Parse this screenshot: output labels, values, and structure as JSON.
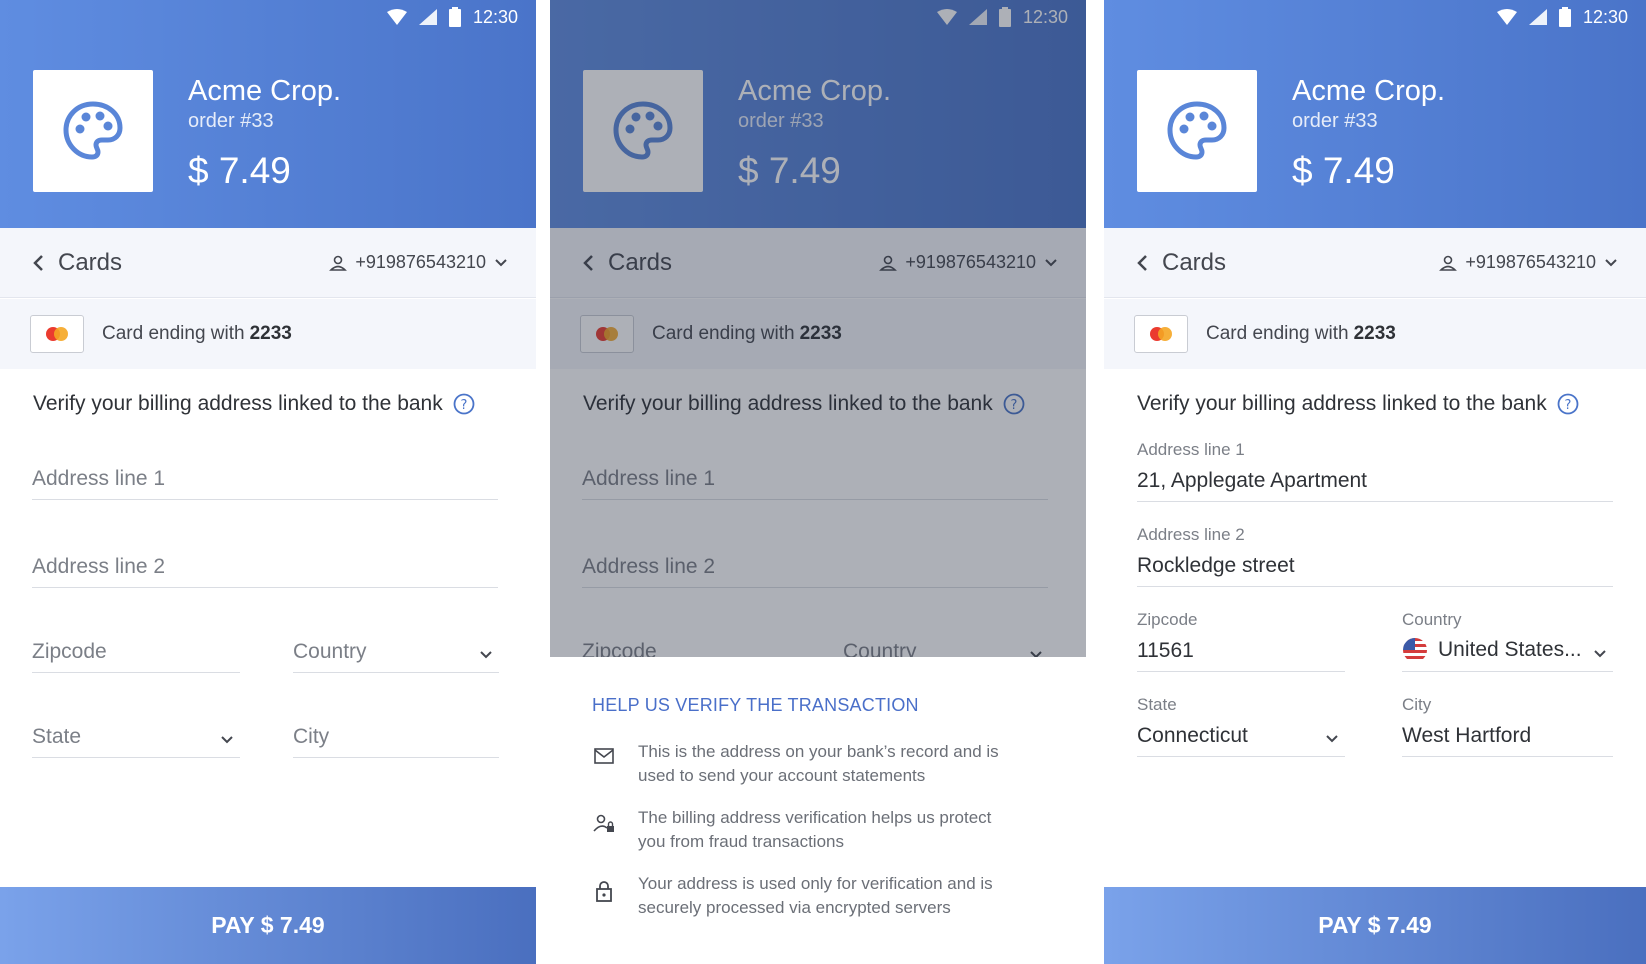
{
  "status": {
    "time": "12:30"
  },
  "merchant": {
    "name": "Acme Crop.",
    "order": "order #33",
    "amount": "$ 7.49"
  },
  "cards_bar": {
    "back_label": "Cards",
    "phone": "+919876543210"
  },
  "card": {
    "prefix": "Card ending with",
    "last4": "2233"
  },
  "verify": {
    "heading": "Verify your billing address linked to the bank"
  },
  "form_empty": {
    "address1_placeholder": "Address line 1",
    "address2_placeholder": "Address line 2",
    "zipcode_placeholder": "Zipcode",
    "country_placeholder": "Country",
    "state_placeholder": "State",
    "city_placeholder": "City"
  },
  "form_filled": {
    "address1_label": "Address line 1",
    "address1_value": "21, Applegate Apartment",
    "address2_label": "Address line 2",
    "address2_value": "Rockledge street",
    "zipcode_label": "Zipcode",
    "zipcode_value": "11561",
    "country_label": "Country",
    "country_value": "United States...",
    "state_label": "State",
    "state_value": "Connecticut",
    "city_label": "City",
    "city_value": "West Hartford"
  },
  "pay_button": {
    "label": "PAY $ 7.49"
  },
  "help_sheet": {
    "title": "HELP US VERIFY THE TRANSACTION",
    "items": [
      {
        "icon": "mail-icon",
        "text": "This is the address on your bank’s record and is used to send your account statements"
      },
      {
        "icon": "user-lock-icon",
        "text": "The billing address verification helps us protect you from fraud transactions"
      },
      {
        "icon": "lock-icon",
        "text": "Your address is used only for verification and is securely processed via encrypted servers"
      }
    ]
  },
  "colors": {
    "brand": "#4a74c9",
    "accent": "#4a6fc9"
  }
}
